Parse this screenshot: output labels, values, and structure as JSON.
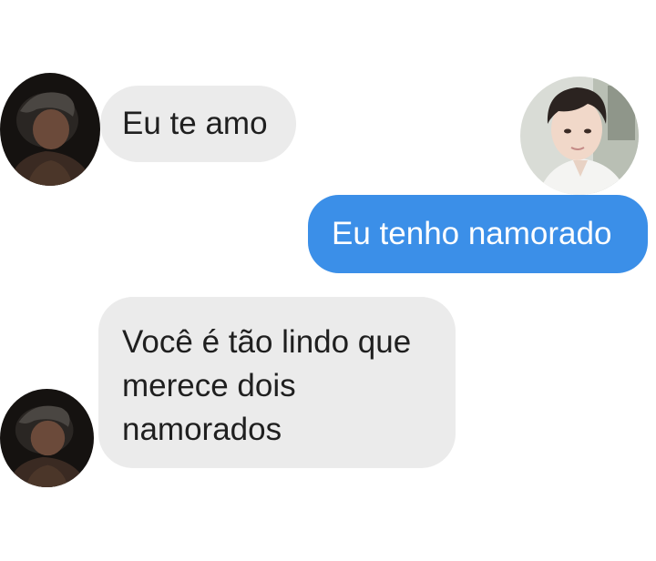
{
  "colors": {
    "incoming_bubble": "#ebebeb",
    "outgoing_bubble": "#3b8fe8",
    "incoming_text": "#1f1f1f",
    "outgoing_text": "#ffffff",
    "background": "#ffffff"
  },
  "messages": [
    {
      "direction": "incoming",
      "avatar": "contact-avatar",
      "lines": [
        "Eu te amo"
      ]
    },
    {
      "direction": "outgoing",
      "avatar": "user-avatar",
      "lines": [
        "Eu tenho namorado"
      ]
    },
    {
      "direction": "incoming",
      "avatar": "contact-avatar",
      "lines": [
        "Você é tão lindo que",
        "merece dois",
        "namorados"
      ]
    }
  ]
}
